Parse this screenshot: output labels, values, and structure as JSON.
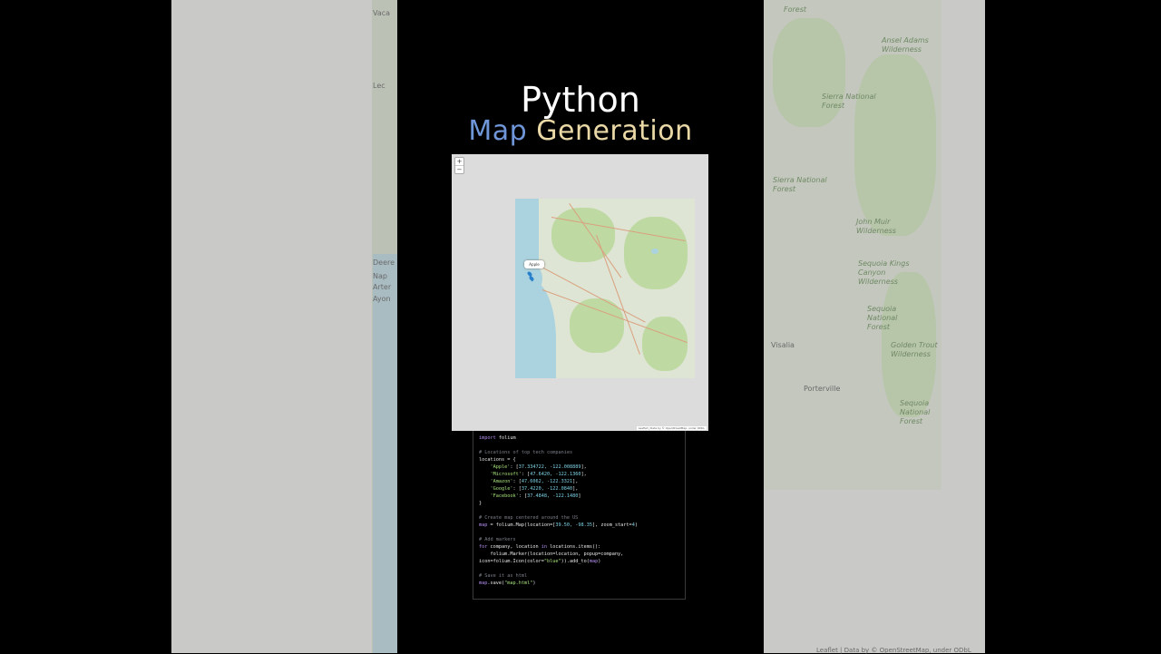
{
  "title": {
    "line1": "Python",
    "line2_word1": "Map",
    "line2_word2": "Generation"
  },
  "colors": {
    "title_word1": "#6f96d9",
    "title_word2": "#ead9a6",
    "background": "#000000"
  },
  "map": {
    "zoom_in": "+",
    "zoom_out": "−",
    "popup": "Apple"
  },
  "side_labels": {
    "left": [
      "Vaca",
      "Deere",
      "Nap",
      "Arter",
      "Ayon",
      "Lec"
    ],
    "right": [
      "Forest",
      "Sierra National Forest",
      "Sierra National Forest",
      "John Muir Wilderness",
      "Sequoia Kings Canyon Wilderness",
      "Sequoia National Forest",
      "Porterville",
      "Visalia",
      "Golden Trout Wilderness",
      "Sequoia National Forest",
      "Ansel Adams Wilderness"
    ]
  },
  "attribution": "Leaflet | Data by © OpenStreetMap, under ODbL",
  "code": {
    "lines": [
      [
        {
          "t": "import",
          "c": "k"
        },
        {
          "t": " folium",
          "c": ""
        }
      ],
      [],
      [
        {
          "t": "# Locations of top tech companies",
          "c": "c"
        }
      ],
      [
        {
          "t": "locations = {",
          "c": ""
        }
      ],
      [
        {
          "t": "    'Apple'",
          "c": "s"
        },
        {
          "t": ": [",
          "c": ""
        },
        {
          "t": "37.334722, -122.008889",
          "c": "n"
        },
        {
          "t": "],",
          "c": ""
        }
      ],
      [
        {
          "t": "    'Microsoft'",
          "c": "s"
        },
        {
          "t": ": [",
          "c": ""
        },
        {
          "t": "47.6420, -122.1360",
          "c": "n"
        },
        {
          "t": "],",
          "c": ""
        }
      ],
      [
        {
          "t": "    'Amazon'",
          "c": "s"
        },
        {
          "t": ": [",
          "c": ""
        },
        {
          "t": "47.6062, -122.3321",
          "c": "n"
        },
        {
          "t": "],",
          "c": ""
        }
      ],
      [
        {
          "t": "    'Google'",
          "c": "s"
        },
        {
          "t": ": [",
          "c": ""
        },
        {
          "t": "37.4220, -122.0840",
          "c": "n"
        },
        {
          "t": "],",
          "c": ""
        }
      ],
      [
        {
          "t": "    'Facebook'",
          "c": "s"
        },
        {
          "t": ": [",
          "c": ""
        },
        {
          "t": "37.4848, -122.1480",
          "c": "n"
        },
        {
          "t": "]",
          "c": ""
        }
      ],
      [
        {
          "t": "}",
          "c": ""
        }
      ],
      [],
      [
        {
          "t": "# Create map centered around the US",
          "c": "c"
        }
      ],
      [
        {
          "t": "map",
          "c": "k"
        },
        {
          "t": " = folium.Map(location=[",
          "c": ""
        },
        {
          "t": "39.50, -98.35",
          "c": "n"
        },
        {
          "t": "], zoom_start=",
          "c": ""
        },
        {
          "t": "4",
          "c": "n"
        },
        {
          "t": ")",
          "c": ""
        }
      ],
      [],
      [
        {
          "t": "# Add markers",
          "c": "c"
        }
      ],
      [
        {
          "t": "for",
          "c": "k"
        },
        {
          "t": " company, location ",
          "c": ""
        },
        {
          "t": "in",
          "c": "k"
        },
        {
          "t": " locations.items():",
          "c": ""
        }
      ],
      [
        {
          "t": "    folium.Marker(location=location, popup=company,",
          "c": ""
        }
      ],
      [
        {
          "t": "icon=folium.Icon(color=",
          "c": ""
        },
        {
          "t": "\"blue\"",
          "c": "s"
        },
        {
          "t": ")).add_to(",
          "c": ""
        },
        {
          "t": "map",
          "c": "k"
        },
        {
          "t": ")",
          "c": ""
        }
      ],
      [],
      [
        {
          "t": "# Save it as html",
          "c": "c"
        }
      ],
      [
        {
          "t": "map",
          "c": "k"
        },
        {
          "t": ".save(",
          "c": ""
        },
        {
          "t": "\"map.html\"",
          "c": "s"
        },
        {
          "t": ")",
          "c": ""
        }
      ]
    ]
  }
}
